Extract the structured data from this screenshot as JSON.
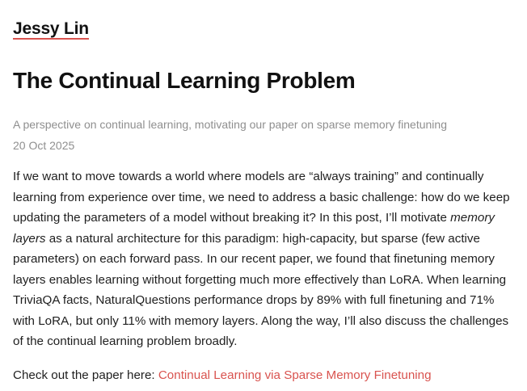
{
  "site": {
    "name": "Jessy Lin"
  },
  "post": {
    "title": "The Continual Learning Problem",
    "subtitle": "A perspective on continual learning, motivating our paper on sparse memory finetuning",
    "date": "20 Oct 2025",
    "body_lines": [
      "If we want to move towards a world where models are “always training” and continually",
      "learning from experience over time, we need to address a basic challenge: how do we keep",
      "updating the parameters of a model without breaking it? In this post, I’ll motivate ",
      "memory",
      "layers",
      " as a natural architecture for this paradigm: high-capacity, but sparse (few active",
      "parameters) on each forward pass. In our recent paper, we found that finetuning memory",
      "layers enables learning without forgetting much more effectively than LoRA. When learning",
      "TriviaQA facts, NaturalQuestions performance drops by 89% with full finetuning and 71%",
      "with LoRA, but only 11% with memory layers. Along the way, I’ll also discuss the challenges",
      "of the continual learning problem broadly."
    ],
    "cta_prefix": "Check out the paper here: ",
    "cta_link_text": "Continual Learning via Sparse Memory Finetuning"
  },
  "colors": {
    "accent": "#d9534f",
    "muted_text": "#8f8f8f",
    "body_text": "#1f1f1f"
  }
}
